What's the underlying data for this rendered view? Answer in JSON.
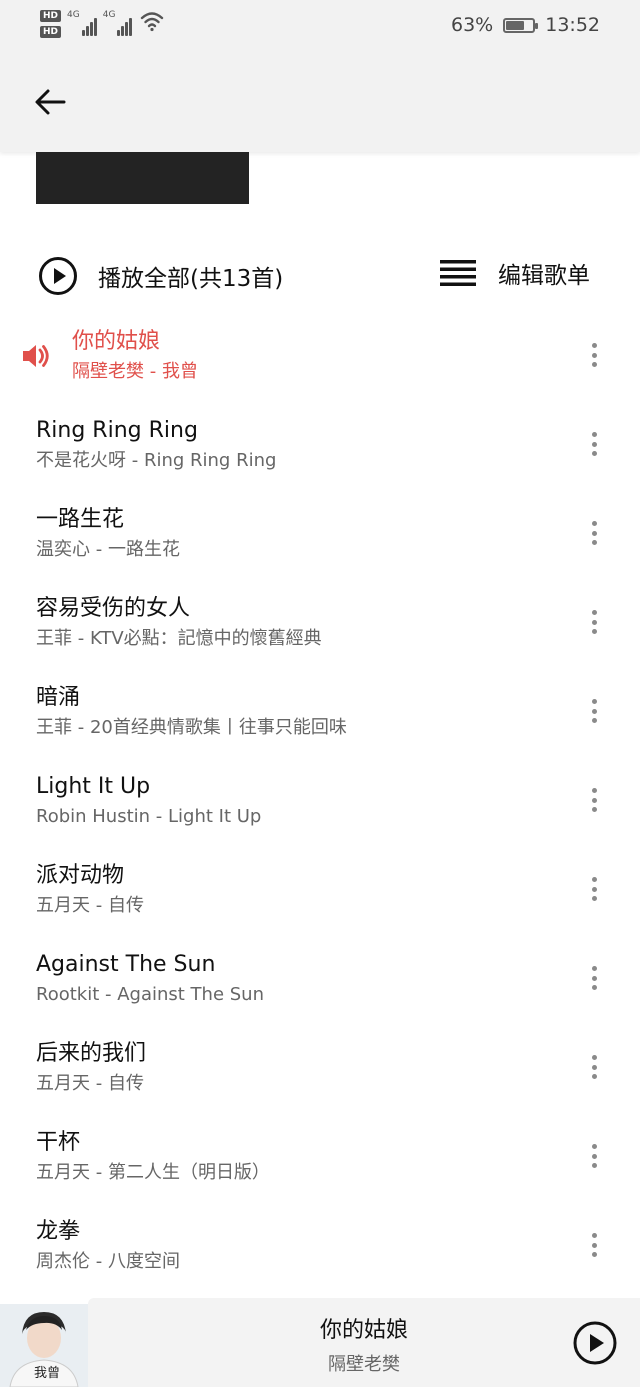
{
  "status_bar": {
    "hd1": "HD",
    "hd2": "HD",
    "net1": "4G",
    "net2": "4G",
    "battery_percent": "63%",
    "battery_level": 0.63,
    "time": "13:52"
  },
  "header": {
    "back_icon": "arrow-left-icon"
  },
  "actions": {
    "play_all_label": "播放全部(共13首)",
    "edit_label": "编辑歌单"
  },
  "songs": [
    {
      "title": "你的姑娘",
      "subtitle": "隔壁老樊 - 我曾",
      "playing": true
    },
    {
      "title": "Ring Ring Ring",
      "subtitle": "不是花火呀 - Ring Ring Ring"
    },
    {
      "title": "一路生花",
      "subtitle": "温奕心 - 一路生花"
    },
    {
      "title": "容易受伤的女人",
      "subtitle": "王菲 - KTV必點：記憶中的懷舊經典"
    },
    {
      "title": "暗涌",
      "subtitle": "王菲 - 20首经典情歌集丨往事只能回味"
    },
    {
      "title": "Light It Up",
      "subtitle": "Robin Hustin - Light It Up"
    },
    {
      "title": "派对动物",
      "subtitle": "五月天 - 自传"
    },
    {
      "title": "Against The Sun",
      "subtitle": "Rootkit - Against The Sun"
    },
    {
      "title": "后来的我们",
      "subtitle": "五月天 - 自传"
    },
    {
      "title": "干杯",
      "subtitle": "五月天 - 第二人生（明日版）"
    },
    {
      "title": "龙拳",
      "subtitle": "周杰伦 - 八度空间"
    }
  ],
  "now_playing": {
    "title": "你的姑娘",
    "artist": "隔壁老樊",
    "cover_text": "我曾"
  },
  "colors": {
    "accent": "#e0504b",
    "header_bg": "#f2f2f2"
  }
}
